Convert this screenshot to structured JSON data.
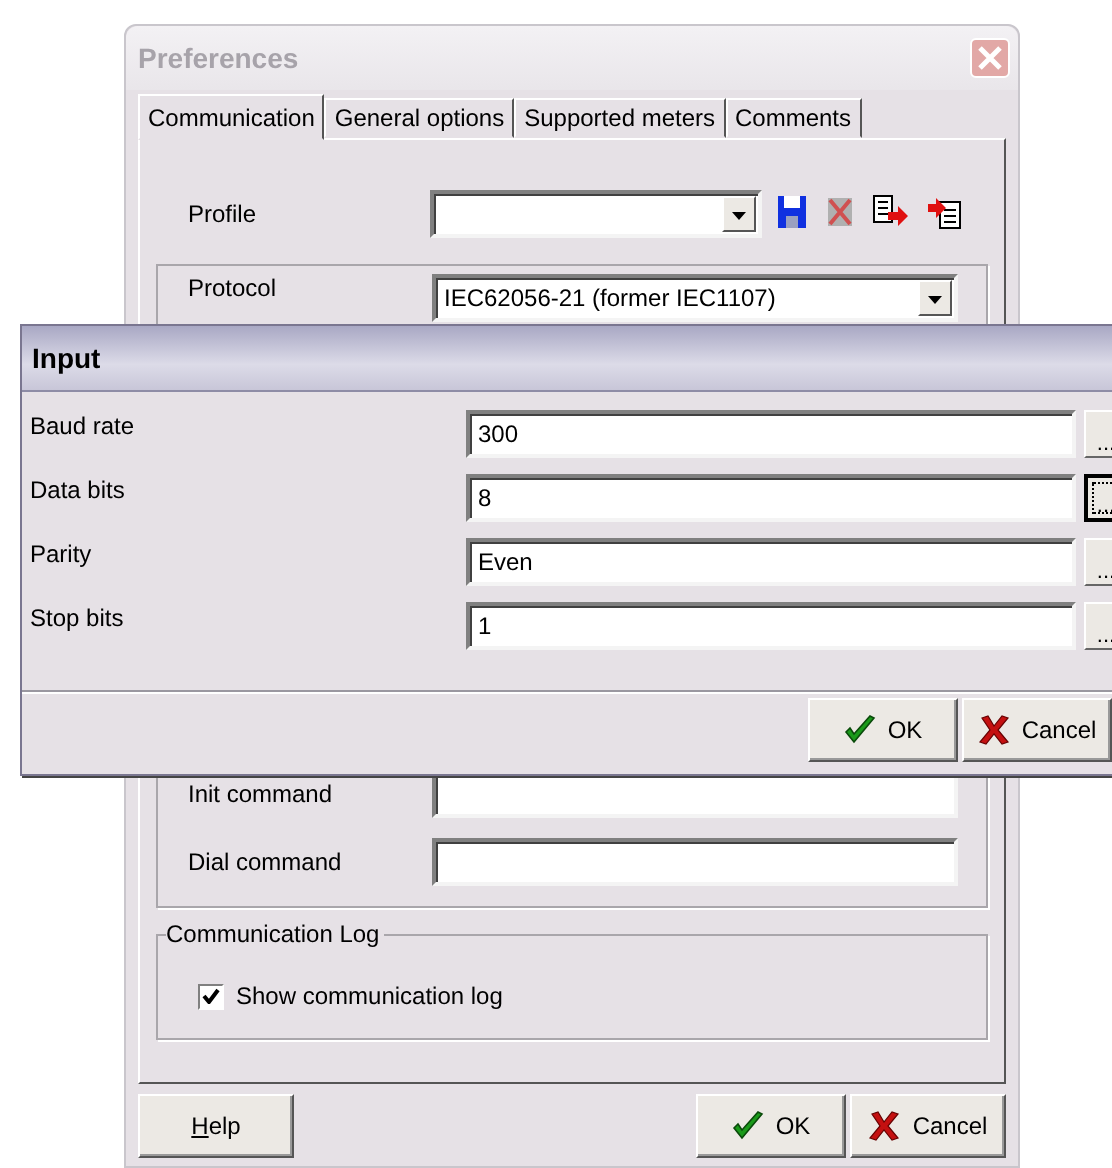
{
  "preferences": {
    "title": "Preferences",
    "tabs": [
      {
        "label": "Communication",
        "selected": true
      },
      {
        "label": "General options",
        "selected": false
      },
      {
        "label": "Supported meters",
        "selected": false
      },
      {
        "label": "Comments",
        "selected": false
      }
    ],
    "profile": {
      "label": "Profile"
    },
    "protocol": {
      "label": "Protocol",
      "value": "IEC62056-21 (former IEC1107)"
    },
    "init_command": {
      "label": "Init command"
    },
    "dial_command": {
      "label": "Dial command"
    },
    "log_group": {
      "title": "Communication Log",
      "checkbox": {
        "label": "Show communication log",
        "checked": true
      }
    },
    "buttons": [
      {
        "kind": "help",
        "label": "Help"
      },
      {
        "kind": "ok",
        "label": "OK"
      },
      {
        "kind": "cancel",
        "label": "Cancel"
      }
    ]
  },
  "input_dialog": {
    "title": "Input",
    "fields": [
      {
        "label": "Baud rate",
        "value": "300",
        "button": "...",
        "focused": false
      },
      {
        "label": "Data bits",
        "value": "8",
        "button": "...",
        "focused": true
      },
      {
        "label": "Parity",
        "value": "Even",
        "button": "...",
        "focused": false
      },
      {
        "label": "Stop bits",
        "value": "1",
        "button": "...",
        "focused": false
      }
    ],
    "buttons": [
      {
        "kind": "ok",
        "label": "OK"
      },
      {
        "kind": "cancel",
        "label": "Cancel"
      }
    ]
  }
}
